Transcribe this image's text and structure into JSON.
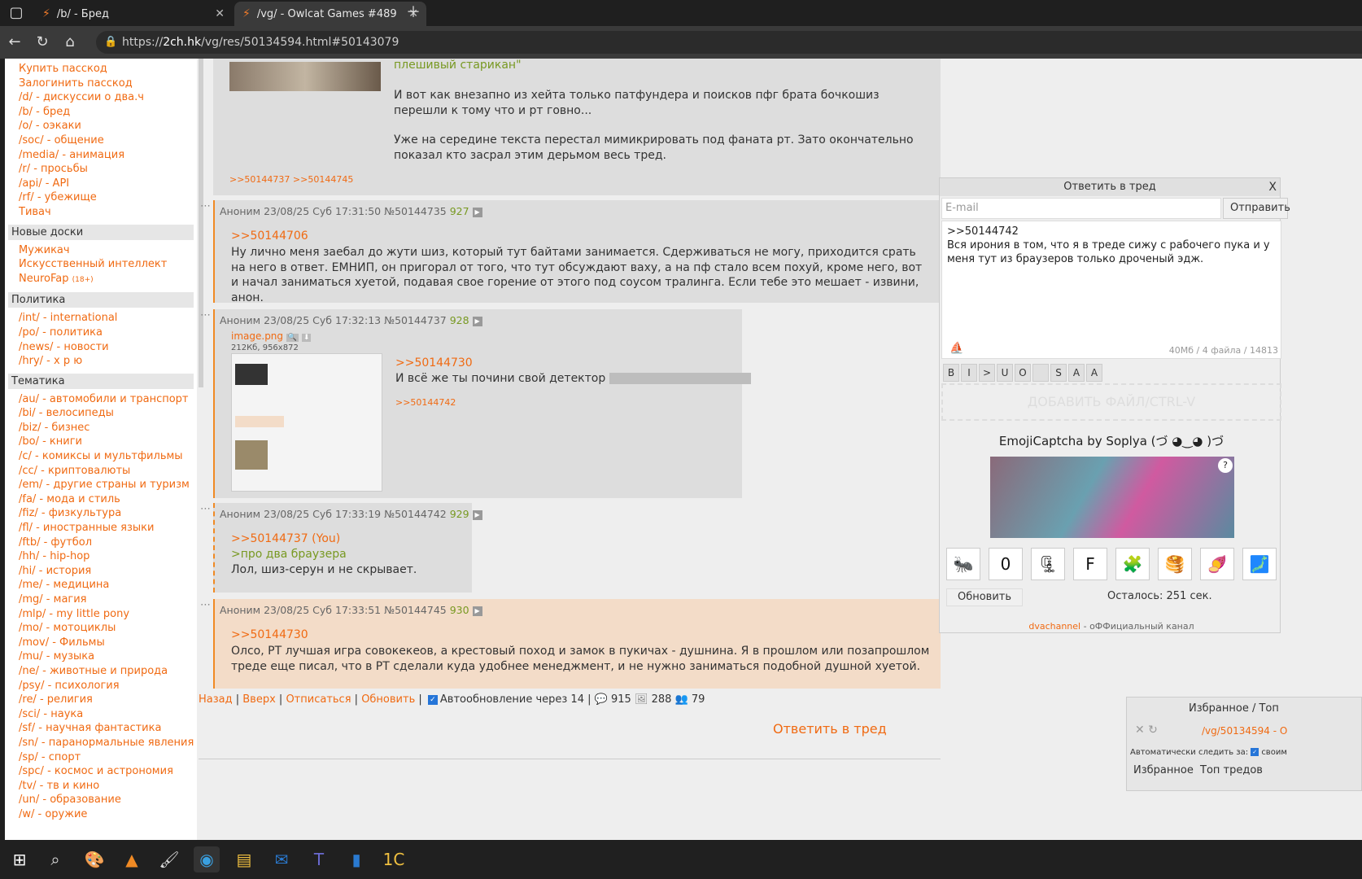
{
  "browser": {
    "tabs": [
      {
        "title": "/b/ - Бред"
      },
      {
        "title": "/vg/ - Owlcat Games #489"
      }
    ],
    "url_prefix": "https://",
    "url_host": "2ch.hk",
    "url_path": "/vg/res/50134594.html#50143079"
  },
  "sidebar": {
    "top_links": [
      "Купить пасскод",
      "Залогинить пасскод",
      "/d/ - дискуссии о два.ч",
      "/b/ - бред",
      "/o/ - оэкаки",
      "/soc/ - общение",
      "/media/ - анимация",
      "/r/ - просьбы",
      "/api/ - API",
      "/rf/ - убежище",
      "Тивач"
    ],
    "sections": [
      {
        "title": "Новые доски",
        "links": [
          "Мужикач",
          "Искусственный интеллект",
          "NeuroFap"
        ],
        "neurofap_badge": "(18+)"
      },
      {
        "title": "Политика",
        "links": [
          "/int/ - international",
          "/po/ - политика",
          "/news/ - новости",
          "/hry/ - х р ю"
        ]
      },
      {
        "title": "Тематика",
        "links": [
          "/au/ - автомобили и транспорт",
          "/bi/ - велосипеды",
          "/biz/ - бизнес",
          "/bo/ - книги",
          "/c/ - комиксы и мультфильмы",
          "/cc/ - криптовалюты",
          "/em/ - другие страны и туризм",
          "/fa/ - мода и стиль",
          "/fiz/ - физкультура",
          "/fl/ - иностранные языки",
          "/ftb/ - футбол",
          "/hh/ - hip-hop",
          "/hi/ - история",
          "/me/ - медицина",
          "/mg/ - магия",
          "/mlp/ - my little pony",
          "/mo/ - мотоциклы",
          "/mov/ - Фильмы",
          "/mu/ - музыка",
          "/ne/ - животные и природа",
          "/psy/ - психология",
          "/re/ - религия",
          "/sci/ - наука",
          "/sf/ - научная фантастика",
          "/sn/ - паранормальные явления",
          "/sp/ - спорт",
          "/spc/ - космос и астрономия",
          "/tv/ - тв и кино",
          "/un/ - образование",
          "/w/ - оружие"
        ]
      }
    ]
  },
  "posts": {
    "p0": {
      "green_top": "плешивый старикан\"",
      "text1": "И вот как внезапно из хейта только патфундера и поисков пфг брата бочкошиз перешли к тому что и рт говно...",
      "text2": "Уже на середине текста перестал мимикрировать под фаната рт. Зато окончательно показал кто засрал этим дерьмом весь тред.",
      "backlinks": ">>50144737 >>50144745"
    },
    "p1": {
      "header": "Аноним 23/08/25 Суб 17:31:50 №50144735",
      "num": "927",
      "reply": ">>50144706",
      "text": "Ну лично меня заебал до жути шиз, который тут байтами занимается. Сдерживаться не могу, приходится срать на него в ответ. ЕМНИП, он пригорал от того, что тут обсуждают ваху, а на пф стало всем похуй, кроме него, вот и начал заниматься хуетой, подавая свое горение от этого под соусом тралинга. Если тебе это мешает - извини, анон."
    },
    "p2": {
      "header": "Аноним 23/08/25 Суб 17:32:13 №50144737",
      "num": "928",
      "file_name": "image.png",
      "file_meta": "212Кб, 956x872",
      "reply": ">>50144730",
      "text": "И всё же ты почини свой детектор",
      "backlink": ">>50144742"
    },
    "p3": {
      "header": "Аноним 23/08/25 Суб 17:33:19 №50144742",
      "num": "929",
      "reply": ">>50144737 (You)",
      "green": ">про два браузера",
      "text": "Лол, шиз-серун и не скрывает."
    },
    "p4": {
      "header": "Аноним 23/08/25 Суб 17:33:51 №50144745",
      "num": "930",
      "reply": ">>50144730",
      "text": "Олсо, РТ лучшая игра совокекеов, а крестовый поход и замок в пукичах - душнина. Я в прошлом или позапрошлом треде еще писал, что в РТ сделали куда удобнее менеджмент, и не нужно заниматься подобной душной хуетой."
    }
  },
  "reply_form": {
    "title": "Ответить в тред",
    "close": "X",
    "email_placeholder": "E-mail",
    "send_label": "Отправить",
    "textarea_value": ">>50144742\nВся ирония в том, что я в треде сижу с рабочего пука и у меня тут из браузеров только дроченый эдж.",
    "limits": "40Мб / 4 файла / 14813",
    "format_buttons": [
      "B",
      "I",
      ">",
      "U",
      "O",
      "",
      "S",
      "A",
      "A"
    ],
    "dropzone": "ДОБАВИТЬ ФАЙЛ/CTRL-V",
    "captcha_title": "EmojiCaptcha by Soplya (づ ◕‿◕ )づ",
    "captcha_help": "?",
    "emoji": [
      "🐜",
      "0",
      "🗜",
      "F",
      "🧩",
      "🥞",
      "🍠",
      "🗾"
    ],
    "refresh_label": "Обновить",
    "remaining": "Осталось: 251 сек.",
    "footer_channel": "dvachannel",
    "footer_text": " - оФФициальный канал"
  },
  "bottom": {
    "back": "Назад",
    "up": "Вверх",
    "unsubscribe": "Отписаться",
    "refresh": "Обновить",
    "auto": "Автообновление через 14",
    "posts_count": "915",
    "files_count": "288",
    "posters_count": "79",
    "big_reply": "Ответить в тред"
  },
  "favorites": {
    "header": "Избранное / Топ",
    "thread": "/vg/50134594 - O",
    "auto_watch": "Автоматически следить за:",
    "auto_watch_tail": "своим",
    "tab_fav": "Избранное",
    "tab_top": "Топ тредов"
  },
  "colors": {
    "accent": "#f06a12",
    "green": "#789922",
    "post_bg": "#dddddd",
    "you_bg": "#f3dcc8"
  }
}
